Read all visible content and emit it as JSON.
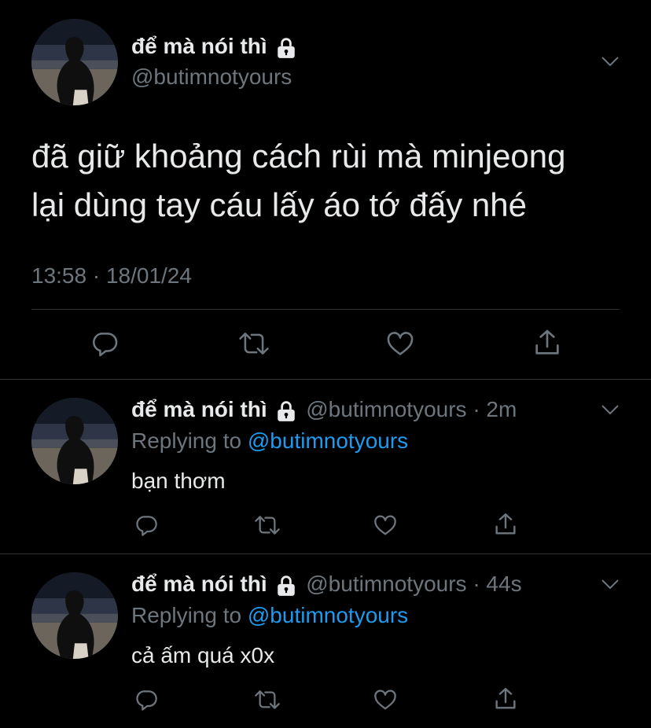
{
  "main_tweet": {
    "display_name": "để mà nói thì",
    "handle": "@butimnotyours",
    "text_line1": "đã giữ khoảng cách rùi mà minjeong",
    "text_line2": "lại dùng tay cáu lấy áo tớ đấy nhé",
    "timestamp": "13:58 · 18/01/24"
  },
  "replies": [
    {
      "display_name": "để mà nói thì",
      "handle": "@butimnotyours",
      "time": "· 2m",
      "replying_prefix": "Replying to",
      "replying_handle": "@butimnotyours",
      "text": "bạn thơm"
    },
    {
      "display_name": "để mà nói thì",
      "handle": "@butimnotyours",
      "time": "· 44s",
      "replying_prefix": "Replying to",
      "replying_handle": "@butimnotyours",
      "text": "cả ấm quá x0x"
    }
  ],
  "icons": [
    "lock-icon",
    "chevron-down-icon",
    "reply-icon",
    "retweet-icon",
    "like-icon",
    "share-icon"
  ],
  "colors": {
    "background": "#000000",
    "text": "#e7e9ea",
    "muted": "#6e767d",
    "link": "#1d9bf0",
    "divider": "#2f3336"
  }
}
